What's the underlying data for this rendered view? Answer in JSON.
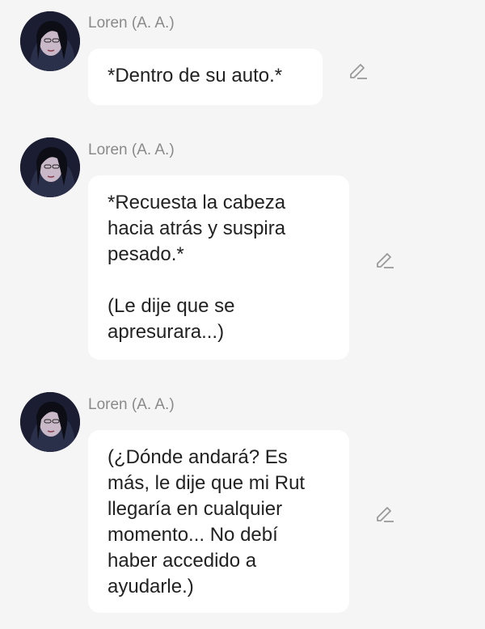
{
  "messages": [
    {
      "sender": "Loren (A. A.)",
      "lines": [
        "*Dentro de su auto.*"
      ],
      "edit_icon": "pencil-icon"
    },
    {
      "sender": "Loren (A. A.)",
      "lines": [
        "*Recuesta la cabeza",
        "hacia atrás y suspira",
        "pesado.*",
        "",
        "(Le dije que se",
        "apresurara...)"
      ],
      "edit_icon": "pencil-icon"
    },
    {
      "sender": "Loren (A. A.)",
      "lines": [
        "(¿Dónde andará? Es",
        "más, le dije que mi Rut",
        "llegaría en cualquier",
        "momento... No debí",
        "haber accedido a",
        "ayudarle.)"
      ],
      "edit_icon": "pencil-icon"
    }
  ],
  "colors": {
    "background": "#f5f5f5",
    "bubble": "#ffffff",
    "sender_text": "#8a8a8a",
    "message_text": "#222222",
    "icon": "#9a9a9a"
  }
}
